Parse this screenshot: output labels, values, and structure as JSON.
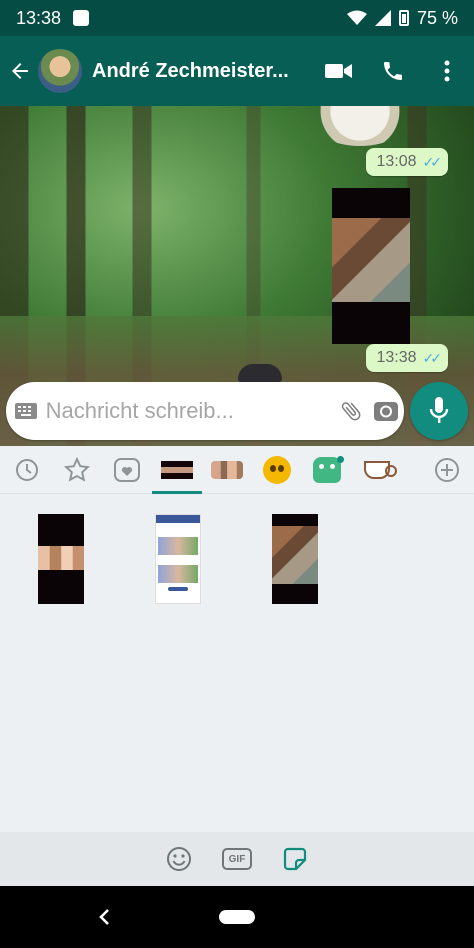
{
  "status_bar": {
    "time": "13:38",
    "battery": "75 %"
  },
  "toolbar": {
    "contact_name": "André Zechmeister..."
  },
  "chat": {
    "messages": [
      {
        "type": "sticker",
        "time": "13:08",
        "status": "read"
      },
      {
        "type": "image",
        "time": "13:38",
        "status": "read"
      }
    ]
  },
  "composer": {
    "placeholder": "Nachricht schreib..."
  },
  "sticker_panel": {
    "tabs": [
      "recent-icon",
      "favorites-star-icon",
      "heart-icon",
      "custom-pack-1",
      "custom-pack-2",
      "yellow-blob-pack",
      "dino-pack",
      "coffee-cup-pack",
      "add-pack-icon"
    ],
    "active_tab": 3,
    "stickers": [
      "family-photo-sticker",
      "screenshot-sticker",
      "rabbit-hutch-sticker"
    ]
  },
  "bottom_bar": {
    "gif_label": "GIF"
  },
  "colors": {
    "primary": "#075e54",
    "accent": "#128c7e",
    "bubble": "#dcf8c6",
    "read_ticks": "#4fa9e0"
  }
}
